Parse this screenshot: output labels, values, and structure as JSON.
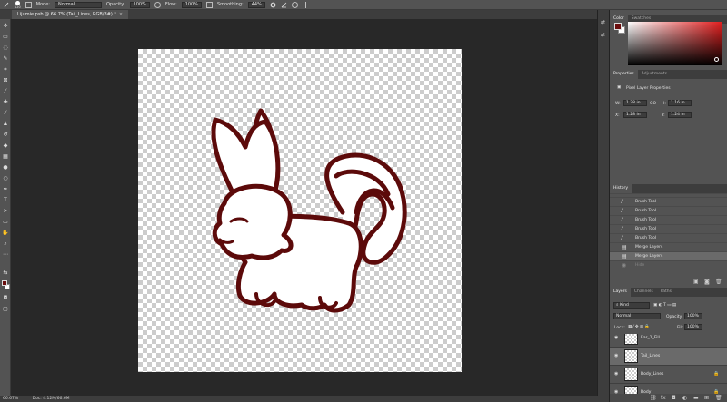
{
  "options_bar": {
    "brush_size": "120",
    "mode_label": "Mode:",
    "mode_value": "Normal",
    "opacity_label": "Opacity:",
    "opacity_value": "100%",
    "flow_label": "Flow:",
    "flow_value": "100%",
    "smoothing_label": "Smoothing:",
    "smoothing_value": "44%"
  },
  "document": {
    "tab_title": "Lijumie.psb @ 66.7% (Tail_Lines, RGB/8#) *",
    "close_glyph": "×"
  },
  "status_bar": {
    "zoom": "66.67%",
    "doc_info": "Doc: 4.12M/66.6M"
  },
  "colors": {
    "foreground": "#6b0e0e",
    "background": "#ffffff",
    "line_color": "#5c0a0a",
    "picker_hue": "#e11d1d"
  },
  "color_panel": {
    "tabs": [
      "Color",
      "Swatches"
    ]
  },
  "properties_panel": {
    "tabs": [
      "Properties",
      "Adjustments"
    ],
    "layer_type": "Pixel Layer Properties",
    "w_label": "W:",
    "w_value": "1.28 in",
    "go_label": "GO",
    "h_label": "H:",
    "h_value": "1.16 in",
    "x_label": "X:",
    "x_value": "1.28 in",
    "y_label": "Y:",
    "y_value": "1.24 in"
  },
  "history_panel": {
    "title": "History",
    "items": [
      {
        "label": "Brush Tool",
        "icon": "brush-icon",
        "state": "normal"
      },
      {
        "label": "Brush Tool",
        "icon": "brush-icon",
        "state": "normal"
      },
      {
        "label": "Brush Tool",
        "icon": "brush-icon",
        "state": "normal"
      },
      {
        "label": "Brush Tool",
        "icon": "brush-icon",
        "state": "normal"
      },
      {
        "label": "Brush Tool",
        "icon": "brush-icon",
        "state": "normal"
      },
      {
        "label": "Brush Tool",
        "icon": "brush-icon",
        "state": "normal"
      },
      {
        "label": "Merge Layers",
        "icon": "merge-icon",
        "state": "normal"
      },
      {
        "label": "Merge Layers",
        "icon": "merge-icon",
        "state": "selected"
      },
      {
        "label": "Hide",
        "icon": "eye-icon",
        "state": "dim"
      }
    ]
  },
  "layers_panel": {
    "tabs": [
      "Layers",
      "Channels",
      "Paths"
    ],
    "filter_label": "Kind",
    "blend_mode": "Normal",
    "opacity_label": "Opacity:",
    "opacity_value": "100%",
    "lock_label": "Lock:",
    "fill_label": "Fill:",
    "fill_value": "100%",
    "layers": [
      {
        "name": "Ear_1_Fill",
        "selected": false
      },
      {
        "name": "Tail_Lines",
        "selected": true
      },
      {
        "name": "Body_Lines",
        "selected": false
      },
      {
        "name": "Body",
        "selected": false
      }
    ]
  }
}
